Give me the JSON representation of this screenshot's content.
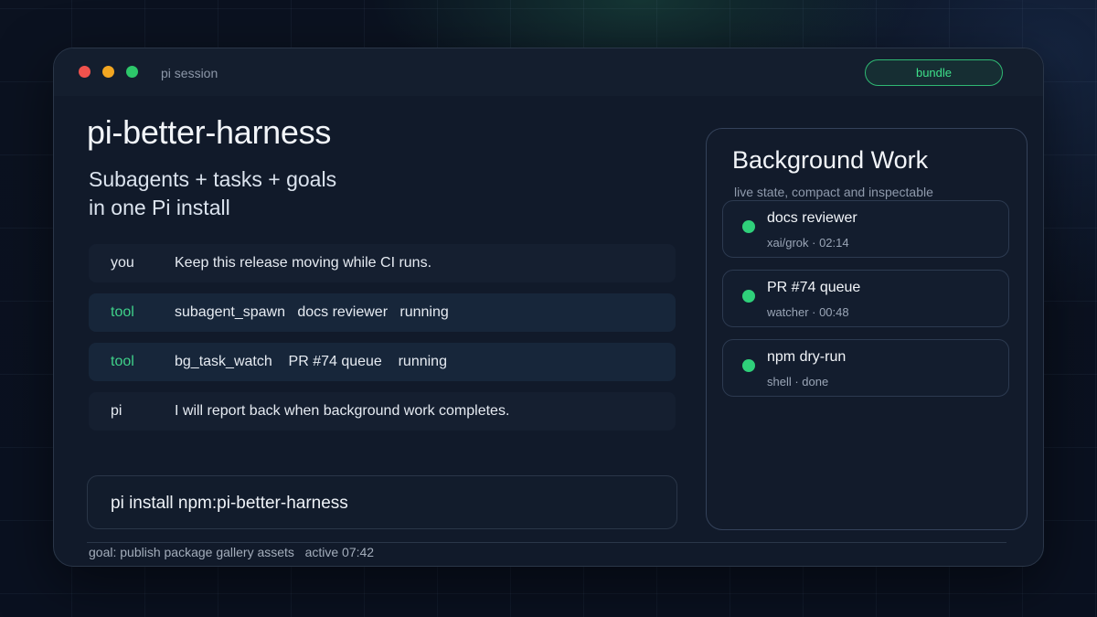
{
  "window": {
    "title": "pi session",
    "bundle_label": "bundle"
  },
  "hero": {
    "title": "pi-better-harness",
    "subtitle_line1": "Subagents + tasks + goals",
    "subtitle_line2": "in one Pi install"
  },
  "chat": [
    {
      "role": "you",
      "content": "Keep this release moving while CI runs."
    },
    {
      "role": "tool",
      "content": "subagent_spawn   docs reviewer   running"
    },
    {
      "role": "tool",
      "content": "bg_task_watch    PR #74 queue    running"
    },
    {
      "role": "pi",
      "content": "I will report back when background work completes."
    }
  ],
  "install": {
    "command": "pi install npm:pi-better-harness"
  },
  "footer": {
    "goal": "goal: publish package gallery assets",
    "status": "active 07:42"
  },
  "background": {
    "title": "Background Work",
    "subtitle": "live state, compact and inspectable",
    "jobs": [
      {
        "name": "docs reviewer",
        "meta": "xai/grok · 02:14"
      },
      {
        "name": "PR #74 queue",
        "meta": "watcher · 00:48"
      },
      {
        "name": "npm dry-run",
        "meta": "shell · done"
      }
    ]
  },
  "colors": {
    "accent": "#3ee08a",
    "status_dot": "#2fd07a",
    "close": "#f0524d",
    "minimize": "#f2a621",
    "maximize": "#2dc76a"
  }
}
